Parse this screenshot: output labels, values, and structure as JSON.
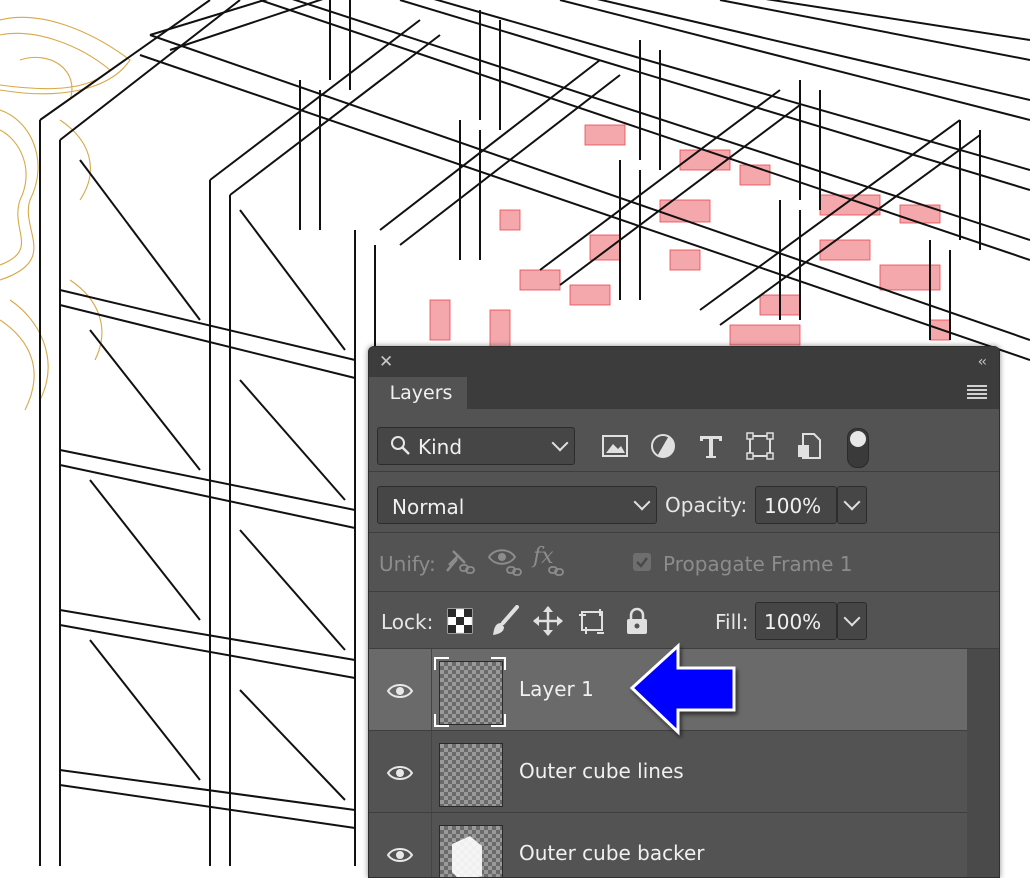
{
  "panel": {
    "tab_label": "Layers",
    "close_glyph": "✕",
    "collapse_glyph": "‹‹",
    "filter": {
      "search_icon": "search-icon",
      "kind_label": "Kind"
    },
    "blend_mode": "Normal",
    "opacity_label": "Opacity:",
    "opacity_value": "100%",
    "unify_label": "Unify:",
    "propagate_label": "Propagate Frame 1",
    "lock_label": "Lock:",
    "fill_label": "Fill:",
    "fill_value": "100%",
    "layers": [
      {
        "name": "Layer 1",
        "selected": true
      },
      {
        "name": "Outer cube lines",
        "selected": false
      },
      {
        "name": "Outer cube backer",
        "selected": false
      }
    ]
  },
  "annotation": {
    "arrow_color": "#0000ff"
  },
  "colors": {
    "panel_bg": "#535353",
    "titlebar": "#3c3c3c",
    "selected_row": "#6a6a6a",
    "accent_red": "#e8474f",
    "accent_gold": "#d7a84a"
  }
}
